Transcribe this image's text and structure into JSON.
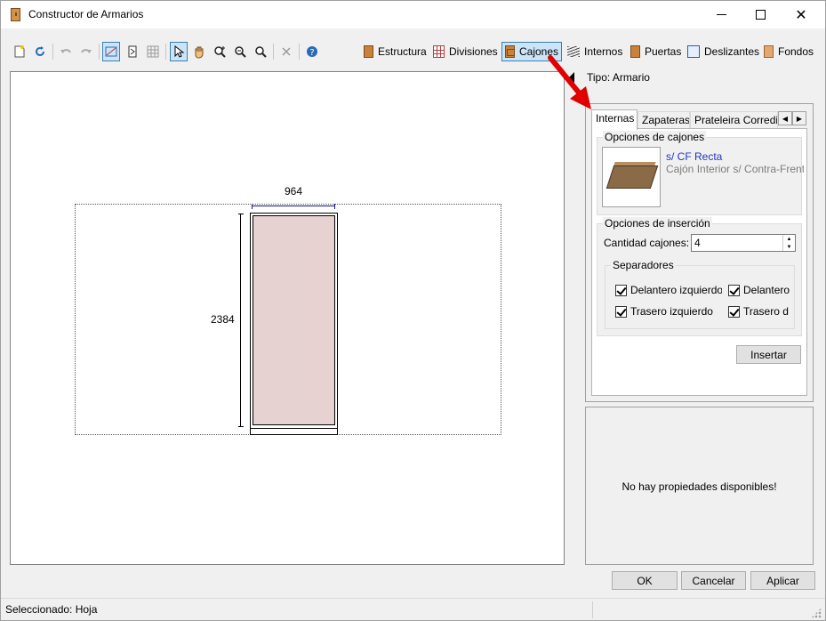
{
  "window": {
    "title": "Constructor de Armarios",
    "minimize_label": "",
    "maximize_label": "",
    "close_label": "✕"
  },
  "toolbar": {
    "icons": [
      "new-icon",
      "refresh-icon",
      "undo-icon",
      "redo-icon",
      "design-mode-icon",
      "frame-icon",
      "grid-icon",
      "pointer-icon",
      "pan-hand-icon",
      "zoom-in-icon",
      "zoom-out-icon",
      "zoom-fit-icon",
      "delete-icon",
      "help-icon"
    ],
    "tabs": [
      {
        "label": "Estructura"
      },
      {
        "label": "Divisiones"
      },
      {
        "label": "Cajones"
      },
      {
        "label": "Internos"
      },
      {
        "label": "Puertas"
      },
      {
        "label": "Deslizantes"
      },
      {
        "label": "Fondos"
      }
    ],
    "active_tab": "Cajones"
  },
  "canvas": {
    "width_dimension": "964",
    "height_dimension": "2384"
  },
  "panel": {
    "tipo": "Tipo: Armario",
    "subtabs": [
      {
        "label": "Internas"
      },
      {
        "label": "Zapateras"
      },
      {
        "label": "Prateleira Corrediça"
      }
    ],
    "opciones_cajones": {
      "legend": "Opciones de cajones",
      "item_title": "s/ CF Recta",
      "item_desc": "Cajón Interior s/ Contra-Frente"
    },
    "opciones_insercion": {
      "legend": "Opciones de inserción",
      "cantidad_label": "Cantidad cajones:",
      "cantidad_value": "4"
    },
    "separadores": {
      "legend": "Separadores",
      "items": [
        {
          "label": "Delantero izquierdo",
          "checked": true
        },
        {
          "label": "Delantero",
          "checked": true
        },
        {
          "label": "Trasero izquierdo",
          "checked": true
        },
        {
          "label": "Trasero d",
          "checked": true
        }
      ]
    },
    "insertar_label": "Insertar",
    "no_props": "No hay propiedades disponibles!"
  },
  "buttons": {
    "ok": "OK",
    "cancel": "Cancelar",
    "apply": "Aplicar"
  },
  "status": {
    "text": "Seleccionado: Hoja"
  },
  "colors": {
    "accent": "#cce4f7",
    "cabinet_fill": "#e7d2d2",
    "annotation_arrow": "#e00000",
    "link": "#1c38c4"
  }
}
